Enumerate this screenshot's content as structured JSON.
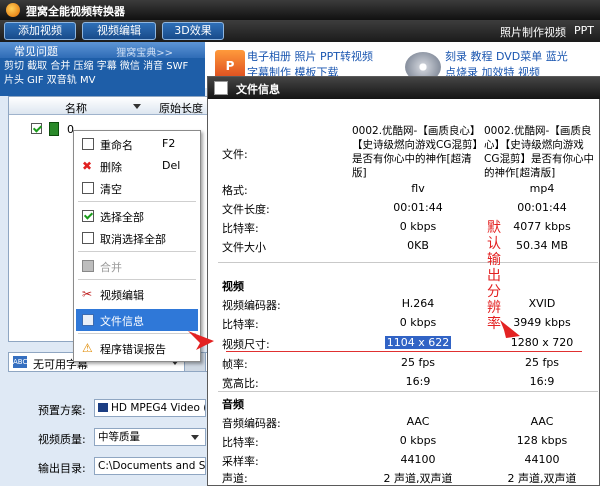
{
  "app": {
    "title": "狸窝全能视频转换器",
    "toolbar": {
      "add_video": "添加视频",
      "video_edit": "视频编辑",
      "effect_3d": "3D效果",
      "right_link1": "照片制作视频",
      "right_link2": "PPT"
    },
    "faq": {
      "header": "常见问题",
      "more": "狸窝宝典>>",
      "links": "剪切 截取 合并 压缩 字幕 微信 消音 SWF 片头 GIF 双音轨 MV"
    },
    "banner": {
      "line1_left": "电子相册 照片 PPT转视频",
      "line1_right": "刻录 教程 DVD菜单 蓝光",
      "line2_left": "字幕制作 模板下载",
      "line2_right": "点烧录 加效特 视频"
    },
    "filelist": {
      "col_name": "名称",
      "col_length": "原始长度",
      "row_index": "0"
    },
    "subtitle_select": "无可用字幕",
    "settings": {
      "preset_label": "预置方案:",
      "preset_value": "HD MPEG4 Video (",
      "quality_label": "视频质量:",
      "quality_value": "中等质量",
      "output_label": "输出目录:",
      "output_value": "C:\\Documents and Set"
    }
  },
  "context_menu": {
    "items": [
      {
        "label": "重命名",
        "shortcut": "F2"
      },
      {
        "label": "删除",
        "shortcut": "Del"
      },
      {
        "label": "清空",
        "shortcut": ""
      },
      {
        "label": "选择全部",
        "shortcut": ""
      },
      {
        "label": "取消选择全部",
        "shortcut": ""
      },
      {
        "label": "合并",
        "shortcut": ""
      },
      {
        "label": "视频编辑",
        "shortcut": ""
      },
      {
        "label": "文件信息",
        "shortcut": ""
      },
      {
        "label": "程序错误报告",
        "shortcut": ""
      }
    ]
  },
  "dialog": {
    "title": "文件信息",
    "file_label": "文件:",
    "file1_name": "0002.优酷网-【画质良心】【史诗级燃向游戏CG混剪】是否有你心中的神作[超清版]",
    "file2_name": "0002.优酷网-【画质良心】【史诗级燃向游戏CG混剪】是否有你心中的神作[超清版]",
    "format_label": "格式:",
    "format1": "flv",
    "format2": "mp4",
    "length_label": "文件长度:",
    "length1": "00:01:44",
    "length2": "00:01:44",
    "bitrate_label": "比特率:",
    "bitrate1": "0 kbps",
    "bitrate2": "4077 kbps",
    "size_label": "文件大小",
    "size1": "0KB",
    "size2": "50.34 MB",
    "video_section": "视频",
    "vcodec_label": "视频编码器:",
    "vcodec1": "H.264",
    "vcodec2": "XVID",
    "vbitrate_label": "比特率:",
    "vbitrate1": "0 kbps",
    "vbitrate2": "3949 kbps",
    "vsize_label": "视频尺寸:",
    "vsize1": "1104 x 622",
    "vsize2": "1280 x 720",
    "fps_label": "帧率:",
    "fps1": "25 fps",
    "fps2": "25 fps",
    "aspect_label": "宽高比:",
    "aspect1": "16:9",
    "aspect2": "16:9",
    "audio_section": "音频",
    "acodec_label": "音频编码器:",
    "acodec1": "AAC",
    "acodec2": "AAC",
    "abitrate_label": "比特率:",
    "abitrate1": "0 kbps",
    "abitrate2": "128 kbps",
    "samplerate_label": "采样率:",
    "samplerate1": "44100",
    "samplerate2": "44100",
    "channel_label": "声道:",
    "channel1": "2 声道,双声道",
    "channel2": "2 声道,双声道"
  },
  "annotation": {
    "text": "默认输出分辨率",
    "color": "#e32222"
  }
}
